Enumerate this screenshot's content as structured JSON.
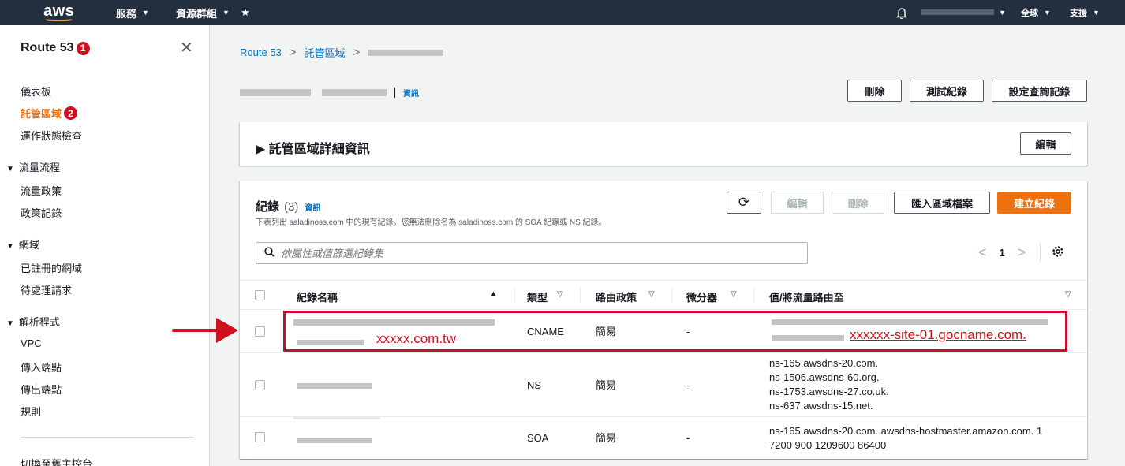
{
  "topnav": {
    "logo": "aws",
    "services": "服務",
    "resource_groups": "資源群組",
    "pin": "★",
    "global": "全球",
    "support": "支援"
  },
  "sidebar": {
    "title": "Route 53",
    "title_badge": "1",
    "items": [
      {
        "label": "儀表板"
      },
      {
        "label": "託管區域",
        "badge": "2",
        "active": true
      },
      {
        "label": "運作狀態檢查"
      }
    ],
    "sections": [
      {
        "title": "流量流程",
        "items": [
          "流量政策",
          "政策記錄"
        ]
      },
      {
        "title": "網域",
        "items": [
          "已註冊的網域",
          "待處理請求"
        ]
      },
      {
        "title": "解析程式",
        "items": [
          "VPC",
          "傳入端點",
          "傳出端點",
          "規則"
        ]
      }
    ],
    "bottom_link": "切換至舊主控台"
  },
  "breadcrumb": {
    "root": "Route 53",
    "zones": "託管區域"
  },
  "page": {
    "info": "資訊",
    "buttons": {
      "delete": "刪除",
      "test": "測試紀錄",
      "query_log": "設定查詢記錄"
    }
  },
  "details": {
    "title": "▶ 託管區域詳細資訊",
    "edit": "編輯"
  },
  "records": {
    "title": "紀錄",
    "count": "(3)",
    "info": "資訊",
    "description": "下表列出 saladinoss.com 中的現有紀錄。您無法刪除名為 saladinoss.com 的 SOA 紀錄或 NS 紀錄。",
    "buttons": {
      "refresh": "⟳",
      "edit": "編輯",
      "delete": "刪除",
      "import": "匯入區域檔案",
      "create": "建立紀錄"
    },
    "search_placeholder": "依屬性或值篩選紀錄集",
    "page": "1",
    "columns": {
      "name": "紀錄名稱",
      "type": "類型",
      "policy": "路由政策",
      "differentiator": "微分器",
      "value": "值/將流量路由至"
    },
    "rows": [
      {
        "name_annotation": "xxxxx.com.tw",
        "type": "CNAME",
        "policy": "簡易",
        "diff": "-",
        "value_annotation": "xxxxxx-site-01.gocname.com."
      },
      {
        "type": "NS",
        "policy": "簡易",
        "diff": "-",
        "values": [
          "ns-165.awsdns-20.com.",
          "ns-1506.awsdns-60.org.",
          "ns-1753.awsdns-27.co.uk.",
          "ns-637.awsdns-15.net."
        ]
      },
      {
        "type": "SOA",
        "policy": "簡易",
        "diff": "-",
        "values": [
          "ns-165.awsdns-20.com. awsdns-hostmaster.amazon.com. 1",
          "7200 900 1209600 86400"
        ]
      }
    ]
  },
  "colors": {
    "accent": "#ec7211",
    "annotation": "#d0101e",
    "nav": "#232f3e",
    "link": "#0073bb"
  }
}
